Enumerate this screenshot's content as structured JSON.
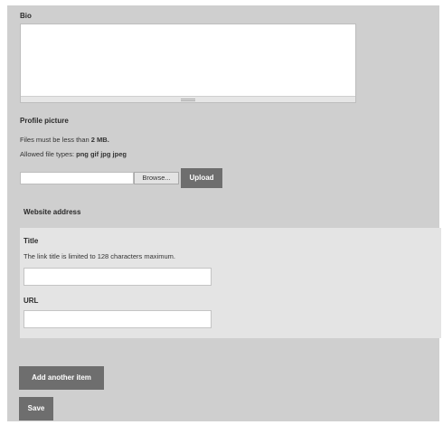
{
  "bio": {
    "label": "Bio"
  },
  "profile_picture": {
    "label": "Profile picture",
    "size_prefix": "Files must be less than",
    "size_limit": "2 MB.",
    "types_prefix": "Allowed file types:",
    "types": "png gif jpg jpeg",
    "browse_label": "Browse...",
    "upload_label": "Upload"
  },
  "website": {
    "legend": "Website address",
    "title_label": "Title",
    "title_help": "The link title is limited to 128 characters maximum.",
    "url_label": "URL",
    "title_value": "",
    "url_value": ""
  },
  "actions": {
    "add_item_label": "Add another item",
    "save_label": "Save"
  }
}
